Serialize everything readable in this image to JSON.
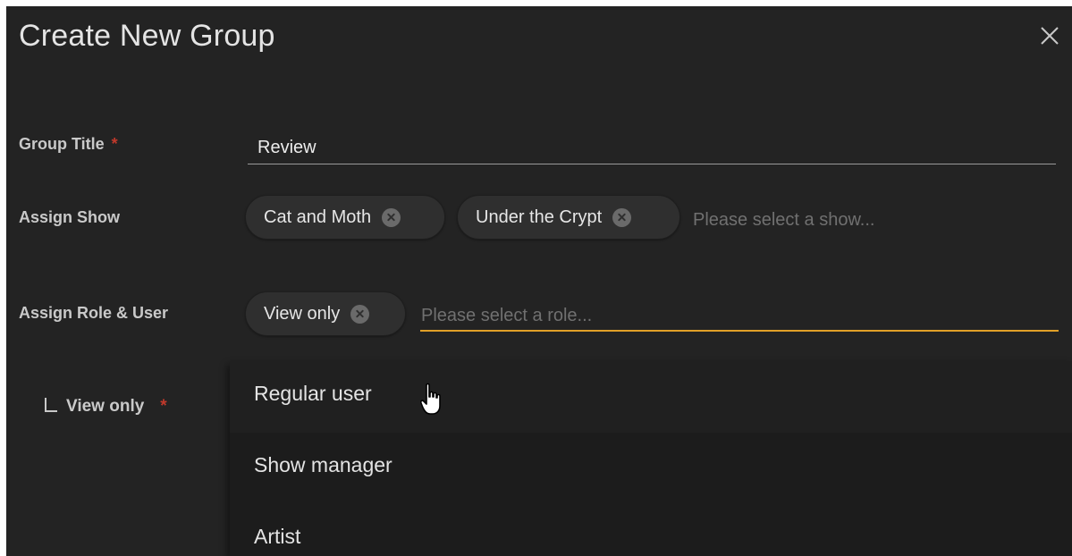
{
  "dialog": {
    "title": "Create New Group",
    "close_icon": "close-icon"
  },
  "group_title": {
    "label": "Group Title",
    "required_mark": "*",
    "value": "Review"
  },
  "assign_show": {
    "label": "Assign Show",
    "chips": [
      "Cat and Moth",
      "Under the Crypt"
    ],
    "placeholder": "Please select a show..."
  },
  "assign_role": {
    "label": "Assign Role & User",
    "chips": [
      "View only"
    ],
    "placeholder": "Please select a role...",
    "accent_color": "#e0a028"
  },
  "sub_role": {
    "label": "View only",
    "required_mark": "*"
  },
  "role_menu": {
    "items": [
      "Regular user",
      "Show manager",
      "Artist"
    ],
    "hovered": "Regular user"
  },
  "colors": {
    "background": "#232323",
    "required": "#c0392b",
    "focus_underline": "#e0a028"
  }
}
